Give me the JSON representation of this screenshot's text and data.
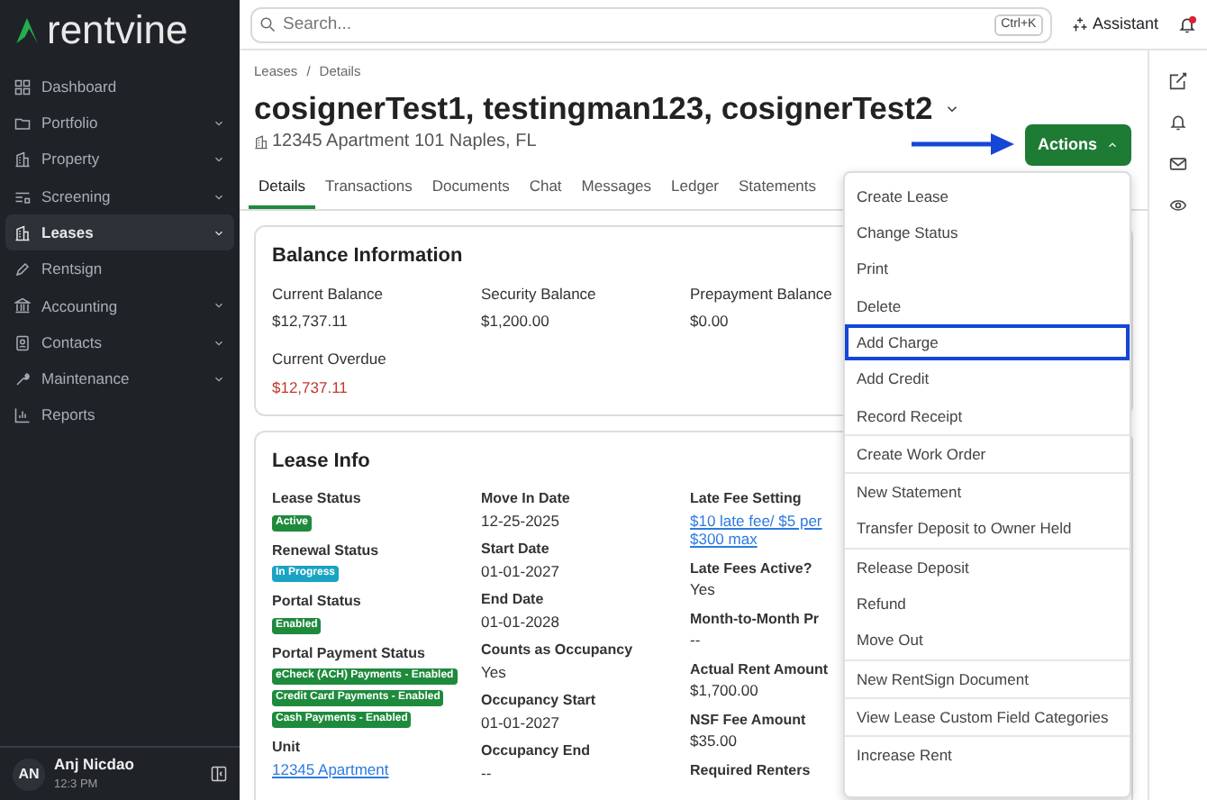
{
  "sidebar": {
    "logo": "rentvine",
    "items": [
      {
        "label": "Dashboard",
        "expandable": false,
        "selected": false
      },
      {
        "label": "Portfolio",
        "expandable": true,
        "selected": false
      },
      {
        "label": "Property",
        "expandable": true,
        "selected": false
      },
      {
        "label": "Screening",
        "expandable": true,
        "selected": false
      },
      {
        "label": "Leases",
        "expandable": true,
        "selected": true
      },
      {
        "label": "Rentsign",
        "expandable": false,
        "selected": false
      },
      {
        "label": "Accounting",
        "expandable": true,
        "selected": false
      },
      {
        "label": "Contacts",
        "expandable": true,
        "selected": false
      },
      {
        "label": "Maintenance",
        "expandable": true,
        "selected": false
      },
      {
        "label": "Reports",
        "expandable": false,
        "selected": false
      }
    ],
    "user": {
      "initials": "AN",
      "name": "Anj Nicdao",
      "time": "12:3 PM"
    }
  },
  "topbar": {
    "search_placeholder": "Search...",
    "shortcut": "Ctrl+K",
    "assistant": "Assistant",
    "notification": true
  },
  "breadcrumb": {
    "items": [
      "Leases",
      "Details"
    ],
    "separator": "/"
  },
  "title": "cosignerTest1, testingman123, cosignerTest2",
  "address": "12345 Apartment 101 Naples, FL",
  "tabs": [
    {
      "label": "Details",
      "selected": true
    },
    {
      "label": "Transactions",
      "selected": false
    },
    {
      "label": "Documents",
      "selected": false
    },
    {
      "label": "Chat",
      "selected": false
    },
    {
      "label": "Messages",
      "selected": false
    },
    {
      "label": "Ledger",
      "selected": false
    },
    {
      "label": "Statements",
      "selected": false
    }
  ],
  "actions_button": "Actions",
  "actions_menu": [
    [
      {
        "label": "Create Lease",
        "highlighted": false
      },
      {
        "label": "Change Status",
        "highlighted": false
      },
      {
        "label": "Print",
        "highlighted": false
      },
      {
        "label": "Delete",
        "highlighted": false
      },
      {
        "label": "Add Charge",
        "highlighted": true
      },
      {
        "label": "Add Credit",
        "highlighted": false
      },
      {
        "label": "Record Receipt",
        "highlighted": false
      }
    ],
    [
      {
        "label": "Create Work Order",
        "highlighted": false
      }
    ],
    [
      {
        "label": "New Statement",
        "highlighted": false
      },
      {
        "label": "Transfer Deposit to Owner Held",
        "highlighted": false
      }
    ],
    [
      {
        "label": "Release Deposit",
        "highlighted": false
      },
      {
        "label": "Refund",
        "highlighted": false
      },
      {
        "label": "Move Out",
        "highlighted": false
      }
    ],
    [
      {
        "label": "New RentSign Document",
        "highlighted": false
      }
    ],
    [
      {
        "label": "View Lease Custom Field Categories",
        "highlighted": false
      }
    ],
    [
      {
        "label": "Increase Rent",
        "highlighted": false
      }
    ]
  ],
  "balance_information": {
    "title": "Balance Information",
    "fields": [
      {
        "label": "Current Balance",
        "value": "$12,737.11",
        "overdue": false
      },
      {
        "label": "Security Balance",
        "value": "$1,200.00",
        "overdue": false
      },
      {
        "label": "Prepayment Balance",
        "value": "$0.00",
        "overdue": false
      },
      {
        "label": "Current Overdue",
        "value": "$12,737.11",
        "overdue": true
      }
    ]
  },
  "lease_info": {
    "title": "Lease Info",
    "columns": [
      [
        {
          "label": "Lease Status",
          "badges": [
            {
              "text": "Active",
              "kind": "success"
            }
          ]
        },
        {
          "label": "Renewal Status",
          "badges": [
            {
              "text": "In Progress",
              "kind": "info"
            }
          ]
        },
        {
          "label": "Portal Status",
          "badges": [
            {
              "text": "Enabled",
              "kind": "success"
            }
          ]
        },
        {
          "label": "Portal Payment Status",
          "badges": [
            {
              "text": "eCheck (ACH) Payments - Enabled",
              "kind": "success"
            },
            {
              "text": "Credit Card Payments - Enabled",
              "kind": "success"
            },
            {
              "text": "Cash Payments - Enabled",
              "kind": "success"
            }
          ]
        },
        {
          "label": "Unit",
          "link": "12345 Apartment"
        }
      ],
      [
        {
          "label": "Move In Date",
          "value": "12-25-2025"
        },
        {
          "label": "Start Date",
          "value": "01-01-2027"
        },
        {
          "label": "End Date",
          "value": "01-01-2028"
        },
        {
          "label": "Counts as Occupancy",
          "value": "Yes"
        },
        {
          "label": "Occupancy Start",
          "value": "01-01-2027"
        },
        {
          "label": "Occupancy End",
          "value": "--"
        }
      ],
      [
        {
          "label": "Late Fee Setting",
          "link": "$10 late fee/ $5 per",
          "link2": "$300 max"
        },
        {
          "label": "Late Fees Active?",
          "value": "Yes"
        },
        {
          "label": "Month-to-Month Pr",
          "value": "--"
        },
        {
          "label": "Actual Rent Amount",
          "value": "$1,700.00"
        },
        {
          "label": "NSF Fee Amount",
          "value": "$35.00"
        },
        {
          "label": "Required Renters"
        }
      ]
    ]
  }
}
